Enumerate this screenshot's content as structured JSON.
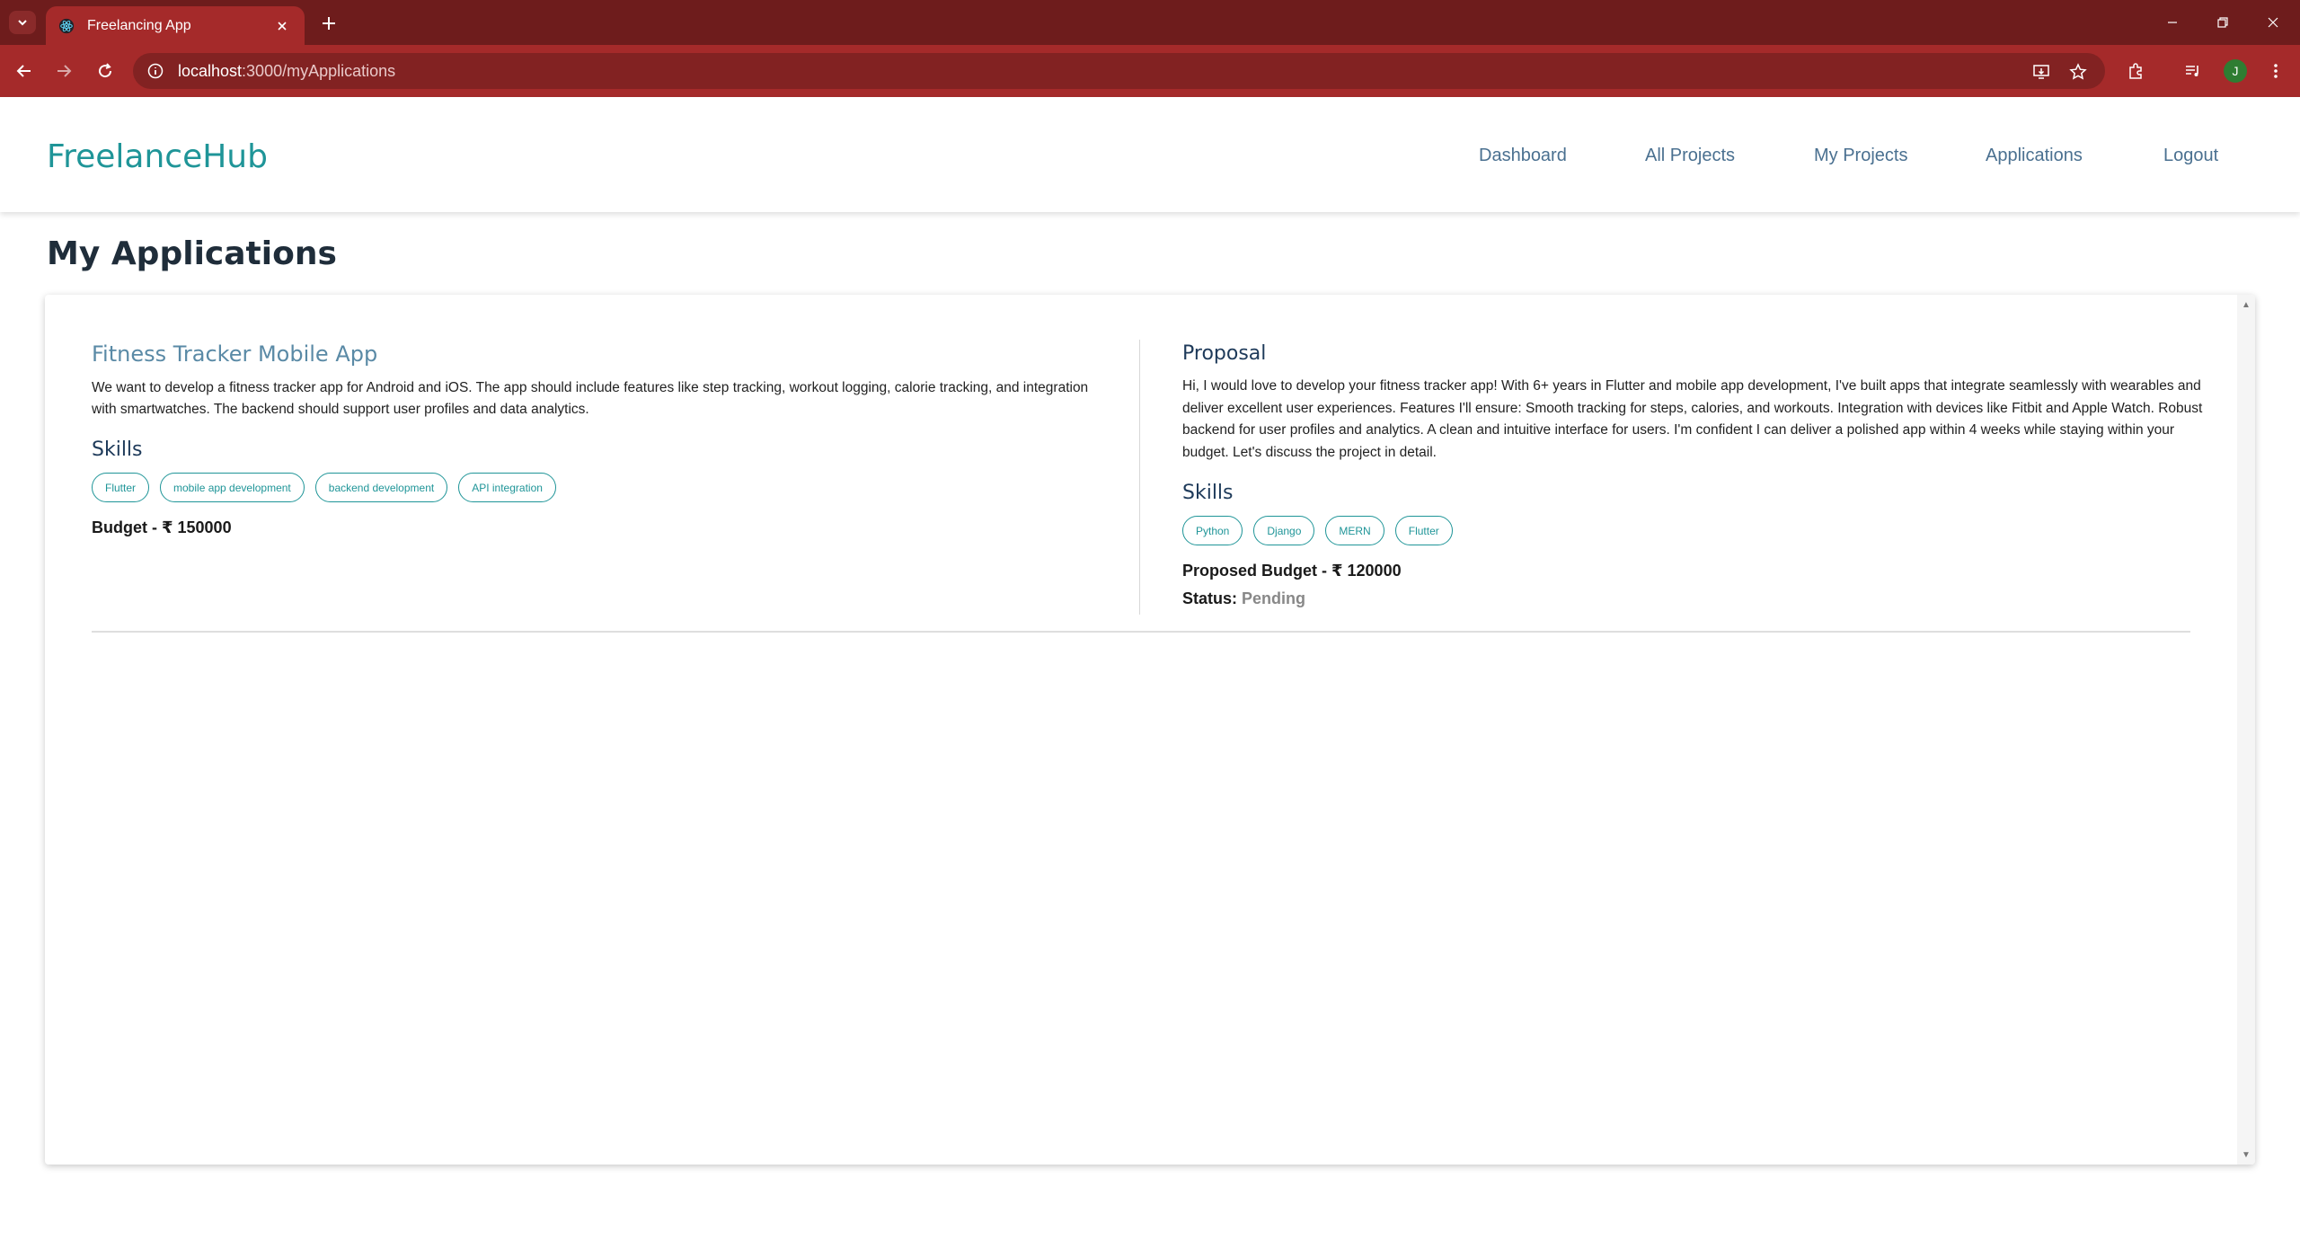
{
  "browser": {
    "tab_title": "Freelancing App",
    "url_host": "localhost",
    "url_path": ":3000/myApplications",
    "profile_initial": "J"
  },
  "app": {
    "brand": "FreelanceHub",
    "nav": [
      "Dashboard",
      "All Projects",
      "My Projects",
      "Applications",
      "Logout"
    ],
    "page_title": "My Applications"
  },
  "application": {
    "project_title": "Fitness Tracker Mobile App",
    "project_description": "We want to develop a fitness tracker app for Android and iOS. The app should include features like step tracking, workout logging, calorie tracking, and integration with smartwatches. The backend should support user profiles and data analytics.",
    "skills_heading": "Skills",
    "project_skills": [
      "Flutter",
      "mobile app development",
      "backend development",
      "API integration"
    ],
    "budget": "Budget - ₹ 150000",
    "proposal_heading": "Proposal",
    "proposal_text": "Hi, I would love to develop your fitness tracker app! With 6+ years in Flutter and mobile app development, I've built apps that integrate seamlessly with wearables and deliver excellent user experiences. Features I'll ensure: Smooth tracking for steps, calories, and workouts. Integration with devices like Fitbit and Apple Watch. Robust backend for user profiles and analytics. A clean and intuitive interface for users. I'm confident I can deliver a polished app within 4 weeks while staying within your budget. Let's discuss the project in detail.",
    "proposal_skills_heading": "Skills",
    "proposal_skills": [
      "Python",
      "Django",
      "MERN",
      "Flutter"
    ],
    "proposed_budget": "Proposed Budget - ₹ 120000",
    "status_label": "Status:",
    "status_value": "Pending"
  },
  "colors": {
    "brand": "#1f9598",
    "browser_frame": "#6e1c1c",
    "browser_toolbar": "#a52a2a"
  }
}
